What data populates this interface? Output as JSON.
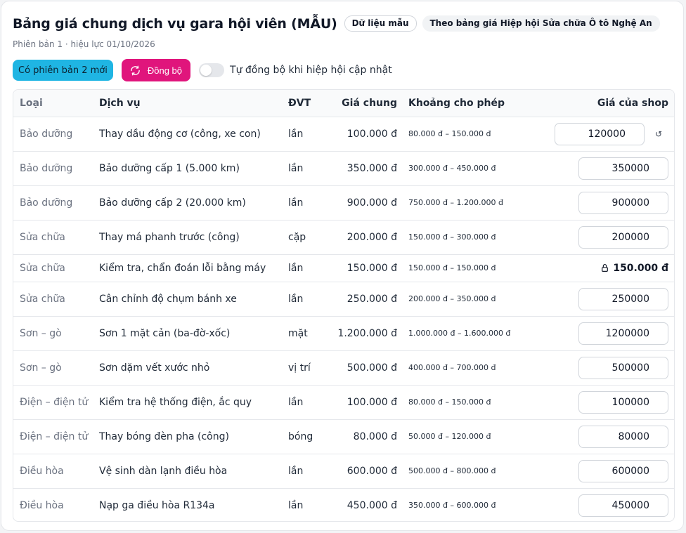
{
  "header": {
    "title": "Bảng giá chung dịch vụ gara hội viên (MẪU)",
    "chip_sample": "Dữ liệu mẫu",
    "chip_source": "Theo bảng giá Hiệp hội Sửa chữa Ô tô Nghệ An",
    "subtitle": "Phiên bản 1 · hiệu lực 01/10/2026"
  },
  "actions": {
    "new_version_badge": "Có phiên bản 2 mới",
    "sync_button": "Đồng bộ",
    "auto_sync_label": "Tự đồng bộ khi hiệp hội cập nhật",
    "auto_sync_on": false
  },
  "colors": {
    "accent_pink": "#e0157c",
    "badge_cyan": "#1fb5e3"
  },
  "table": {
    "columns": {
      "type": "Loại",
      "service": "Dịch vụ",
      "unit": "ĐVT",
      "price": "Giá chung",
      "range": "Khoảng cho phép",
      "shop": "Giá của shop"
    },
    "rows": [
      {
        "type": "Bảo dưỡng",
        "service": "Thay dầu động cơ (công, xe con)",
        "unit": "lần",
        "price": "100.000 đ",
        "range": "80.000 đ – 150.000 đ",
        "shop": "120000",
        "locked": false,
        "reset": true
      },
      {
        "type": "Bảo dưỡng",
        "service": "Bảo dưỡng cấp 1 (5.000 km)",
        "unit": "lần",
        "price": "350.000 đ",
        "range": "300.000 đ – 450.000 đ",
        "shop": "350000",
        "locked": false,
        "reset": false
      },
      {
        "type": "Bảo dưỡng",
        "service": "Bảo dưỡng cấp 2 (20.000 km)",
        "unit": "lần",
        "price": "900.000 đ",
        "range": "750.000 đ – 1.200.000 đ",
        "shop": "900000",
        "locked": false,
        "reset": false
      },
      {
        "type": "Sửa chữa",
        "service": "Thay má phanh trước (công)",
        "unit": "cặp",
        "price": "200.000 đ",
        "range": "150.000 đ – 300.000 đ",
        "shop": "200000",
        "locked": false,
        "reset": false
      },
      {
        "type": "Sửa chữa",
        "service": "Kiểm tra, chẩn đoán lỗi bằng máy",
        "unit": "lần",
        "price": "150.000 đ",
        "range": "150.000 đ – 150.000 đ",
        "shop": "150.000 đ",
        "locked": true,
        "reset": false
      },
      {
        "type": "Sửa chữa",
        "service": "Cân chỉnh độ chụm bánh xe",
        "unit": "lần",
        "price": "250.000 đ",
        "range": "200.000 đ – 350.000 đ",
        "shop": "250000",
        "locked": false,
        "reset": false
      },
      {
        "type": "Sơn – gò",
        "service": "Sơn 1 mặt cản (ba-đờ-xốc)",
        "unit": "mặt",
        "price": "1.200.000 đ",
        "range": "1.000.000 đ – 1.600.000 đ",
        "shop": "1200000",
        "locked": false,
        "reset": false
      },
      {
        "type": "Sơn – gò",
        "service": "Sơn dặm vết xước nhỏ",
        "unit": "vị trí",
        "price": "500.000 đ",
        "range": "400.000 đ – 700.000 đ",
        "shop": "500000",
        "locked": false,
        "reset": false
      },
      {
        "type": "Điện – điện tử",
        "service": "Kiểm tra hệ thống điện, ắc quy",
        "unit": "lần",
        "price": "100.000 đ",
        "range": "80.000 đ – 150.000 đ",
        "shop": "100000",
        "locked": false,
        "reset": false
      },
      {
        "type": "Điện – điện tử",
        "service": "Thay bóng đèn pha (công)",
        "unit": "bóng",
        "price": "80.000 đ",
        "range": "50.000 đ – 120.000 đ",
        "shop": "80000",
        "locked": false,
        "reset": false
      },
      {
        "type": "Điều hòa",
        "service": "Vệ sinh dàn lạnh điều hòa",
        "unit": "lần",
        "price": "600.000 đ",
        "range": "500.000 đ – 800.000 đ",
        "shop": "600000",
        "locked": false,
        "reset": false
      },
      {
        "type": "Điều hòa",
        "service": "Nạp ga điều hòa R134a",
        "unit": "lần",
        "price": "450.000 đ",
        "range": "350.000 đ – 600.000 đ",
        "shop": "450000",
        "locked": false,
        "reset": false
      }
    ]
  }
}
